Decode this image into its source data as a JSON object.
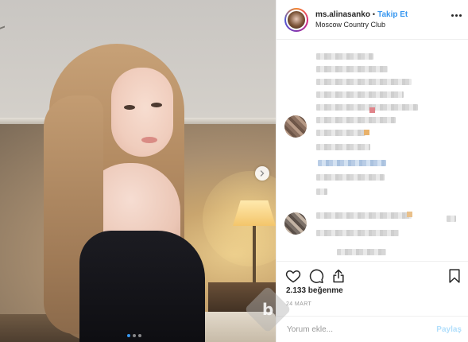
{
  "header": {
    "username": "ms.alinasanko",
    "separator": "•",
    "follow_label": "Takip Et",
    "location": "Moscow Country Club"
  },
  "photo": {
    "carousel_slides": 3,
    "active_slide": 1
  },
  "actions": {
    "like_icon": "heart-icon",
    "comment_icon": "comment-icon",
    "share_icon": "share-icon",
    "save_icon": "bookmark-icon"
  },
  "stats": {
    "likes_text": "2.133 beğenme",
    "date_text": "24 MART"
  },
  "comment_input": {
    "placeholder": "Yorum ekle...",
    "post_label": "Paylaş"
  },
  "watermark": {
    "glyph": "b"
  },
  "colors": {
    "accent": "#3897f0",
    "post_disabled": "#b2dffc",
    "text": "#262626",
    "muted": "#999999"
  }
}
